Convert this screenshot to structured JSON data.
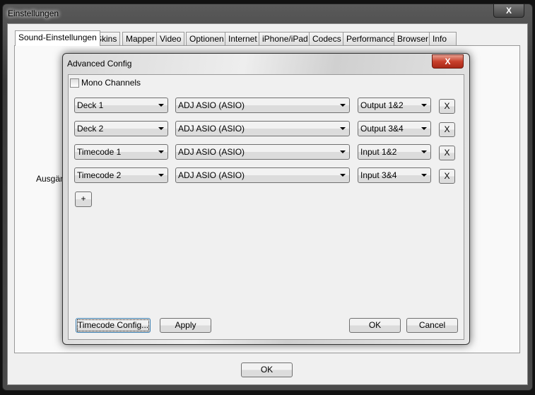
{
  "window": {
    "title": "Einstellungen",
    "close_label": "X"
  },
  "tabs": [
    "Sound-Einstellungen",
    "Skins",
    "Mapper",
    "Video",
    "Optionen",
    "Internet",
    "iPhone/iPad",
    "Codecs",
    "Performance",
    "Browser",
    "Info"
  ],
  "panel": {
    "outputs_label": "Ausgän",
    "ok_label": "OK"
  },
  "dialog": {
    "title": "Advanced Config",
    "close_label": "X",
    "mono_channels": {
      "label": "Mono Channels",
      "checked": false
    },
    "rows": [
      {
        "channel": "Deck 1",
        "device": "ADJ ASIO (ASIO)",
        "port": "Output 1&2",
        "remove": "X"
      },
      {
        "channel": "Deck 2",
        "device": "ADJ ASIO (ASIO)",
        "port": "Output 3&4",
        "remove": "X"
      },
      {
        "channel": "Timecode 1",
        "device": "ADJ ASIO (ASIO)",
        "port": "Input 1&2",
        "remove": "X"
      },
      {
        "channel": "Timecode 2",
        "device": "ADJ ASIO (ASIO)",
        "port": "Input 3&4",
        "remove": "X"
      }
    ],
    "add_label": "+",
    "timecode_config_label": "Timecode Config...",
    "apply_label": "Apply",
    "ok_label": "OK",
    "cancel_label": "Cancel"
  }
}
